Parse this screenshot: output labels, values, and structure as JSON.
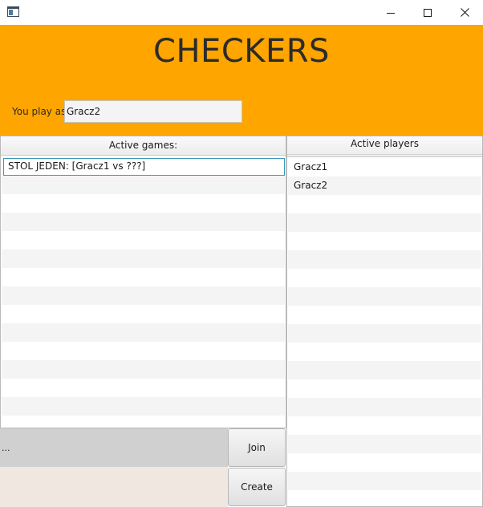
{
  "window": {
    "icon": "window-app-icon",
    "controls": [
      "minimize-icon",
      "maximize-icon",
      "close-icon"
    ]
  },
  "header": {
    "title": "CHECKERS",
    "play_as_label": "You play as:",
    "player_name_value": "Gracz2",
    "background_color": "#ffa500"
  },
  "games": {
    "header": "Active games:",
    "items": [
      {
        "label": "STOL JEDEN: [Gracz1 vs ???]",
        "selected": true
      }
    ]
  },
  "players": {
    "header": "Active players",
    "items": [
      "Gracz1",
      "Gracz2"
    ]
  },
  "status": {
    "text": "..."
  },
  "buttons": {
    "join_label": "Join",
    "create_label": "Create"
  }
}
